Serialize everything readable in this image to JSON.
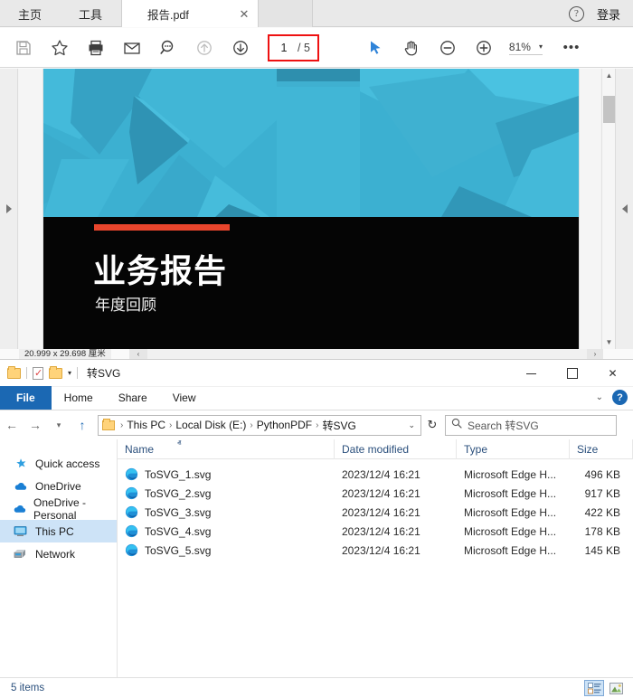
{
  "pdf_reader": {
    "tabs": [
      {
        "label": "主页",
        "name": "tab-home"
      },
      {
        "label": "工具",
        "name": "tab-tools"
      }
    ],
    "document_tab": {
      "label": "报告.pdf",
      "close_label": "✕"
    },
    "titlebar_right": {
      "help_label": "?",
      "signin_label": "登录"
    },
    "toolbar": {
      "icons": [
        {
          "name": "save-icon",
          "label": "save"
        },
        {
          "name": "star-icon",
          "label": "add to favorites"
        },
        {
          "name": "print-icon",
          "label": "print"
        },
        {
          "name": "email-icon",
          "label": "email"
        },
        {
          "name": "search-icon",
          "label": "find"
        },
        {
          "name": "previous-page-icon",
          "label": "previous page"
        },
        {
          "name": "next-page-icon",
          "label": "next page"
        },
        {
          "name": "select-tool-icon",
          "label": "select"
        },
        {
          "name": "hand-tool-icon",
          "label": "pan"
        },
        {
          "name": "zoom-out-icon",
          "label": "zoom out"
        },
        {
          "name": "zoom-in-icon",
          "label": "zoom in"
        },
        {
          "name": "more-options-icon",
          "label": "more tools"
        }
      ],
      "current_page": "1",
      "total_pages": "/ 5",
      "zoom_level": "81%",
      "zoom_dropdown": "▾",
      "more_label": "•••",
      "page_box_highlight_color": "#ee1111"
    },
    "page_content": {
      "title": "业务报告",
      "subtitle": "年度回顾",
      "hero_color": "#3bafd0",
      "accent_bar_color": "#e8452c",
      "background_color": "#050505"
    },
    "status": {
      "dimensions": "20.999 x 29.698 厘米",
      "scroll_left": "‹",
      "scroll_right": "›"
    },
    "rails": {
      "left_expand": "▶",
      "right_collapse": "◀",
      "scroll_up": "▲",
      "scroll_down": "▼"
    }
  },
  "explorer": {
    "titlebar": {
      "folder_name": "转SVG",
      "quick_access_chevron": "▾"
    },
    "window_controls": {
      "minimize": "",
      "maximize": "",
      "close": "✕"
    },
    "ribbon": {
      "tabs": [
        {
          "label": "File",
          "name": "ribbon-tab-file"
        },
        {
          "label": "Home",
          "name": "ribbon-tab-home"
        },
        {
          "label": "Share",
          "name": "ribbon-tab-share"
        },
        {
          "label": "View",
          "name": "ribbon-tab-view"
        }
      ],
      "expand_chevron": "⌄",
      "help_label": "?",
      "file_tab_color": "#1b68b3"
    },
    "address_bar": {
      "back": "←",
      "forward": "→",
      "up": "↑",
      "breadcrumbs": [
        "This PC",
        "Local Disk (E:)",
        "PythonPDF",
        "转SVG"
      ],
      "separator": "›",
      "dropdown": "⌄",
      "refresh": "↻",
      "search_placeholder": "Search 转SVG",
      "search_value": ""
    },
    "nav_pane": {
      "items": [
        {
          "label": "Quick access",
          "icon": "star-icon",
          "selected": false
        },
        {
          "label": "OneDrive",
          "icon": "cloud-icon",
          "selected": false
        },
        {
          "label": "OneDrive - Personal",
          "icon": "cloud-icon",
          "selected": false
        },
        {
          "label": "This PC",
          "icon": "monitor-icon",
          "selected": true
        },
        {
          "label": "Network",
          "icon": "network-icon",
          "selected": false
        }
      ]
    },
    "file_list": {
      "columns": [
        "Name",
        "Date modified",
        "Type",
        "Size"
      ],
      "sort_indicator": "ⱏ",
      "rows": [
        {
          "name": "ToSVG_1.svg",
          "date": "2023/12/4 16:21",
          "type": "Microsoft Edge H...",
          "size": "496 KB"
        },
        {
          "name": "ToSVG_2.svg",
          "date": "2023/12/4 16:21",
          "type": "Microsoft Edge H...",
          "size": "917 KB"
        },
        {
          "name": "ToSVG_3.svg",
          "date": "2023/12/4 16:21",
          "type": "Microsoft Edge H...",
          "size": "422 KB"
        },
        {
          "name": "ToSVG_4.svg",
          "date": "2023/12/4 16:21",
          "type": "Microsoft Edge H...",
          "size": "178 KB"
        },
        {
          "name": "ToSVG_5.svg",
          "date": "2023/12/4 16:21",
          "type": "Microsoft Edge H...",
          "size": "145 KB"
        }
      ]
    },
    "status_bar": {
      "item_count": "5 items",
      "view_details": "details-view",
      "view_large_icons": "large-icons-view"
    }
  }
}
